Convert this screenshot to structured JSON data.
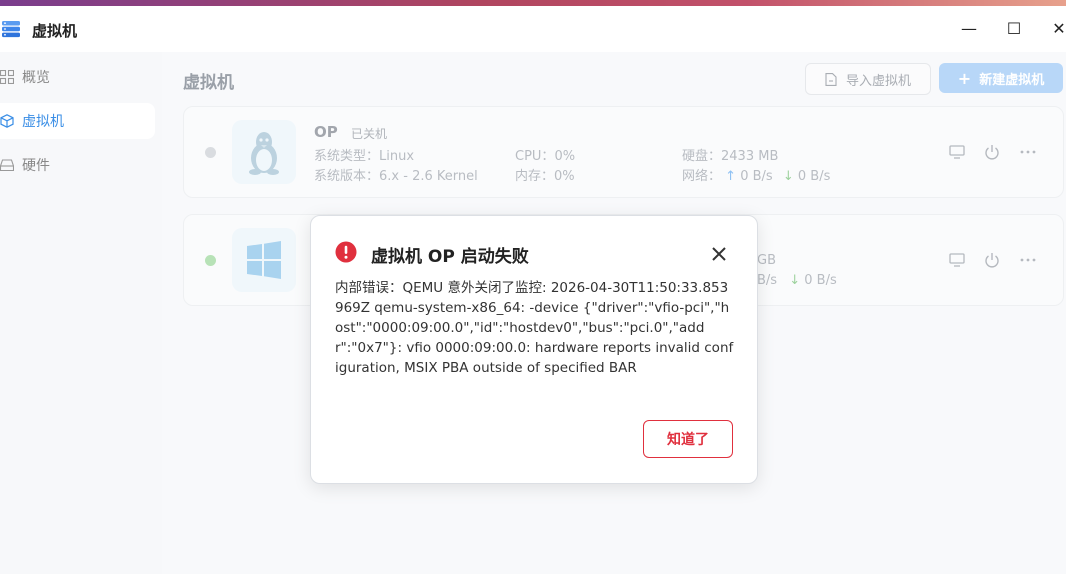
{
  "app": {
    "title": "虚拟机"
  },
  "window": {
    "minimize": "—",
    "maximize": "☐",
    "close": "✕"
  },
  "sidebar": {
    "items": [
      {
        "label": "概览",
        "icon": "grid-icon",
        "active": false
      },
      {
        "label": "虚拟机",
        "icon": "cube-icon",
        "active": true
      },
      {
        "label": "硬件",
        "icon": "drive-icon",
        "active": false
      }
    ]
  },
  "main": {
    "title": "虚拟机",
    "import_label": "导入虚拟机",
    "new_label": "新建虚拟机",
    "new_plus": "+"
  },
  "vms": [
    {
      "name": "OP",
      "state": "已关机",
      "status_color": "#d9dce0",
      "os_icon": "linux-icon",
      "system_type_label": "系统类型：",
      "system_type": "Linux",
      "system_version_label": "系统版本：",
      "system_version": "6.x - 2.6 Kernel",
      "cpu_label": "CPU：",
      "cpu": "0%",
      "mem_label": "内存：",
      "mem": "0%",
      "disk_label": "硬盘：",
      "disk": "2433 MB",
      "net_label": "网络：",
      "net_up": "0 B/s",
      "net_down": "0 B/s"
    },
    {
      "name": "",
      "state": "",
      "status_color": "#b7e2b7",
      "os_icon": "windows-icon",
      "disk_partial": "GB",
      "net_up_partial": "B/s",
      "net_down": "0 B/s"
    }
  ],
  "dialog": {
    "icon": "error-icon",
    "title": "虚拟机 OP 启动失败",
    "message": "内部错误：QEMU 意外关闭了监控: 2026-04-30T11:50:33.853969Z qemu-system-x86_64: -device {\"driver\":\"vfio-pci\",\"host\":\"0000:09:00.0\",\"id\":\"hostdev0\",\"bus\":\"pci.0\",\"addr\":\"0x7\"}: vfio 0000:09:00.0: hardware reports invalid configuration, MSIX PBA outside of specified BAR",
    "ok_label": "知道了"
  },
  "colors": {
    "accent": "#3a8ee6",
    "danger": "#e0303e"
  }
}
